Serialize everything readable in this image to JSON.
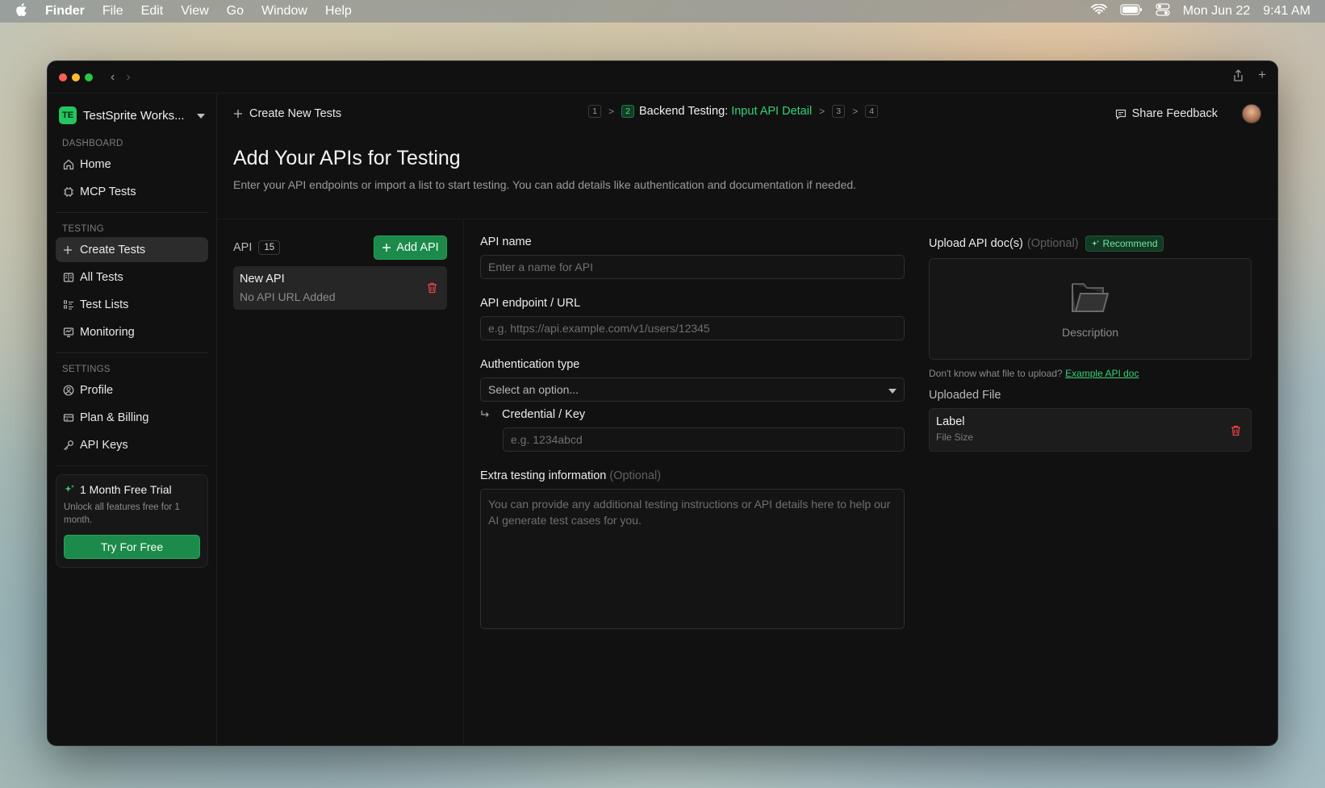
{
  "menubar": {
    "app": "Finder",
    "items": [
      "File",
      "Edit",
      "View",
      "Go",
      "Window",
      "Help"
    ],
    "date": "Mon Jun 22",
    "time": "9:41 AM"
  },
  "sidebar": {
    "workspace_initials": "TE",
    "workspace_name": "TestSprite Works...",
    "sections": {
      "dashboard": "DASHBOARD",
      "testing": "TESTING",
      "settings": "SETTINGS"
    },
    "items": {
      "home": "Home",
      "mcp_tests": "MCP Tests",
      "create_tests": "Create Tests",
      "all_tests": "All Tests",
      "test_lists": "Test Lists",
      "monitoring": "Monitoring",
      "profile": "Profile",
      "plan_billing": "Plan & Billing",
      "api_keys": "API Keys"
    },
    "trial": {
      "title": "1 Month Free Trial",
      "desc": "Unlock all features free for 1 month.",
      "button": "Try For Free"
    }
  },
  "topbar": {
    "create_label": "Create New Tests",
    "steps": {
      "s1": "1",
      "s2": "2",
      "s3": "3",
      "s4": "4"
    },
    "current_step_prefix": "Backend Testing:",
    "current_step_name": "Input API Detail",
    "share_feedback": "Share Feedback"
  },
  "page": {
    "title": "Add Your APIs for Testing",
    "subtitle": "Enter your API endpoints or import a list to start testing. You can add details like authentication and documentation if needed."
  },
  "api_list": {
    "label": "API",
    "count": "15",
    "add_button": "Add API",
    "item_name": "New API",
    "item_url": "No API URL Added"
  },
  "form": {
    "api_name_label": "API name",
    "api_name_placeholder": "Enter a name for API",
    "endpoint_label": "API endpoint / URL",
    "endpoint_placeholder": "e.g. https://api.example.com/v1/users/12345",
    "auth_label": "Authentication type",
    "auth_value": "Select an option...",
    "credential_label": "Credential / Key",
    "credential_placeholder": "e.g. 1234abcd",
    "extra_label": "Extra testing information",
    "optional": "(Optional)",
    "extra_placeholder": "You can provide any additional testing instructions or API details here to help our AI generate test cases for you."
  },
  "upload": {
    "label": "Upload API doc(s)",
    "optional": "(Optional)",
    "recommend": "Recommend",
    "dropzone_desc": "Description",
    "hint_text": "Don't know what file to upload?",
    "hint_link": "Example API doc",
    "uploaded_label": "Uploaded File",
    "file_label": "Label",
    "file_size": "File Size"
  },
  "colors": {
    "accent": "#34d27a",
    "button_green": "#1c8a4a",
    "danger": "#ef4444",
    "background": "#111111"
  }
}
